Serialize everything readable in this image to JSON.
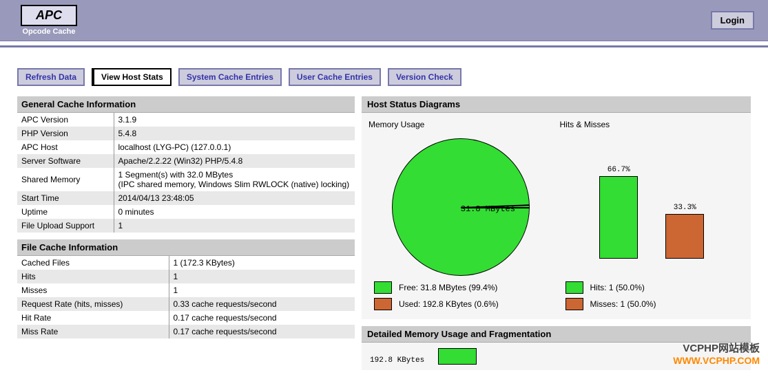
{
  "header": {
    "logo_main": "APC",
    "logo_sub": "Opcode Cache",
    "login_label": "Login"
  },
  "nav": {
    "refresh": "Refresh Data",
    "view_host": "View Host Stats",
    "system_cache": "System Cache Entries",
    "user_cache": "User Cache Entries",
    "version_check": "Version Check"
  },
  "general_cache": {
    "title": "General Cache Information",
    "rows": [
      {
        "label": "APC Version",
        "value": "3.1.9"
      },
      {
        "label": "PHP Version",
        "value": "5.4.8"
      },
      {
        "label": "APC Host",
        "value": "localhost (LYG-PC) (127.0.0.1)"
      },
      {
        "label": "Server Software",
        "value": "Apache/2.2.22 (Win32) PHP/5.4.8"
      },
      {
        "label": "Shared Memory",
        "value": "1 Segment(s) with 32.0 MBytes\n(IPC shared memory, Windows Slim RWLOCK (native) locking)"
      },
      {
        "label": "Start Time",
        "value": "2014/04/13 23:48:05"
      },
      {
        "label": "Uptime",
        "value": "0 minutes"
      },
      {
        "label": "File Upload Support",
        "value": "1"
      }
    ]
  },
  "file_cache": {
    "title": "File Cache Information",
    "rows": [
      {
        "label": "Cached Files",
        "value": "1 (172.3 KBytes)"
      },
      {
        "label": "Hits",
        "value": "1"
      },
      {
        "label": "Misses",
        "value": "1"
      },
      {
        "label": "Request Rate (hits, misses)",
        "value": "0.33 cache requests/second"
      },
      {
        "label": "Hit Rate",
        "value": "0.17 cache requests/second"
      },
      {
        "label": "Miss Rate",
        "value": "0.17 cache requests/second"
      }
    ]
  },
  "diagrams": {
    "title": "Host Status Diagrams",
    "memory": {
      "title": "Memory Usage",
      "pie_label": "31.8 MBytes",
      "legend_free": "Free: 31.8 MBytes (99.4%)",
      "legend_used": "Used: 192.8 KBytes (0.6%)"
    },
    "hits": {
      "title": "Hits & Misses",
      "bar1_label": "66.7%",
      "bar2_label": "33.3%",
      "legend_hits": "Hits: 1 (50.0%)",
      "legend_misses": "Misses: 1 (50.0%)"
    },
    "fragmentation": {
      "title": "Detailed Memory Usage and Fragmentation",
      "label": "192.8 KBytes"
    }
  },
  "watermark": {
    "line1": "VCPHP网站模板",
    "line2": "WWW.VCPHP.COM"
  },
  "chart_data": [
    {
      "type": "pie",
      "title": "Memory Usage",
      "series": [
        {
          "name": "Free",
          "value": 31.8,
          "unit": "MBytes",
          "percent": 99.4
        },
        {
          "name": "Used",
          "value": 192.8,
          "unit": "KBytes",
          "percent": 0.6
        }
      ]
    },
    {
      "type": "bar",
      "title": "Hits & Misses",
      "categories": [
        "Hits",
        "Misses"
      ],
      "values": [
        66.7,
        33.3
      ],
      "legend": [
        {
          "name": "Hits",
          "count": 1,
          "percent": 50.0
        },
        {
          "name": "Misses",
          "count": 1,
          "percent": 50.0
        }
      ],
      "ylim": [
        0,
        100
      ],
      "ylabel": "%"
    }
  ]
}
